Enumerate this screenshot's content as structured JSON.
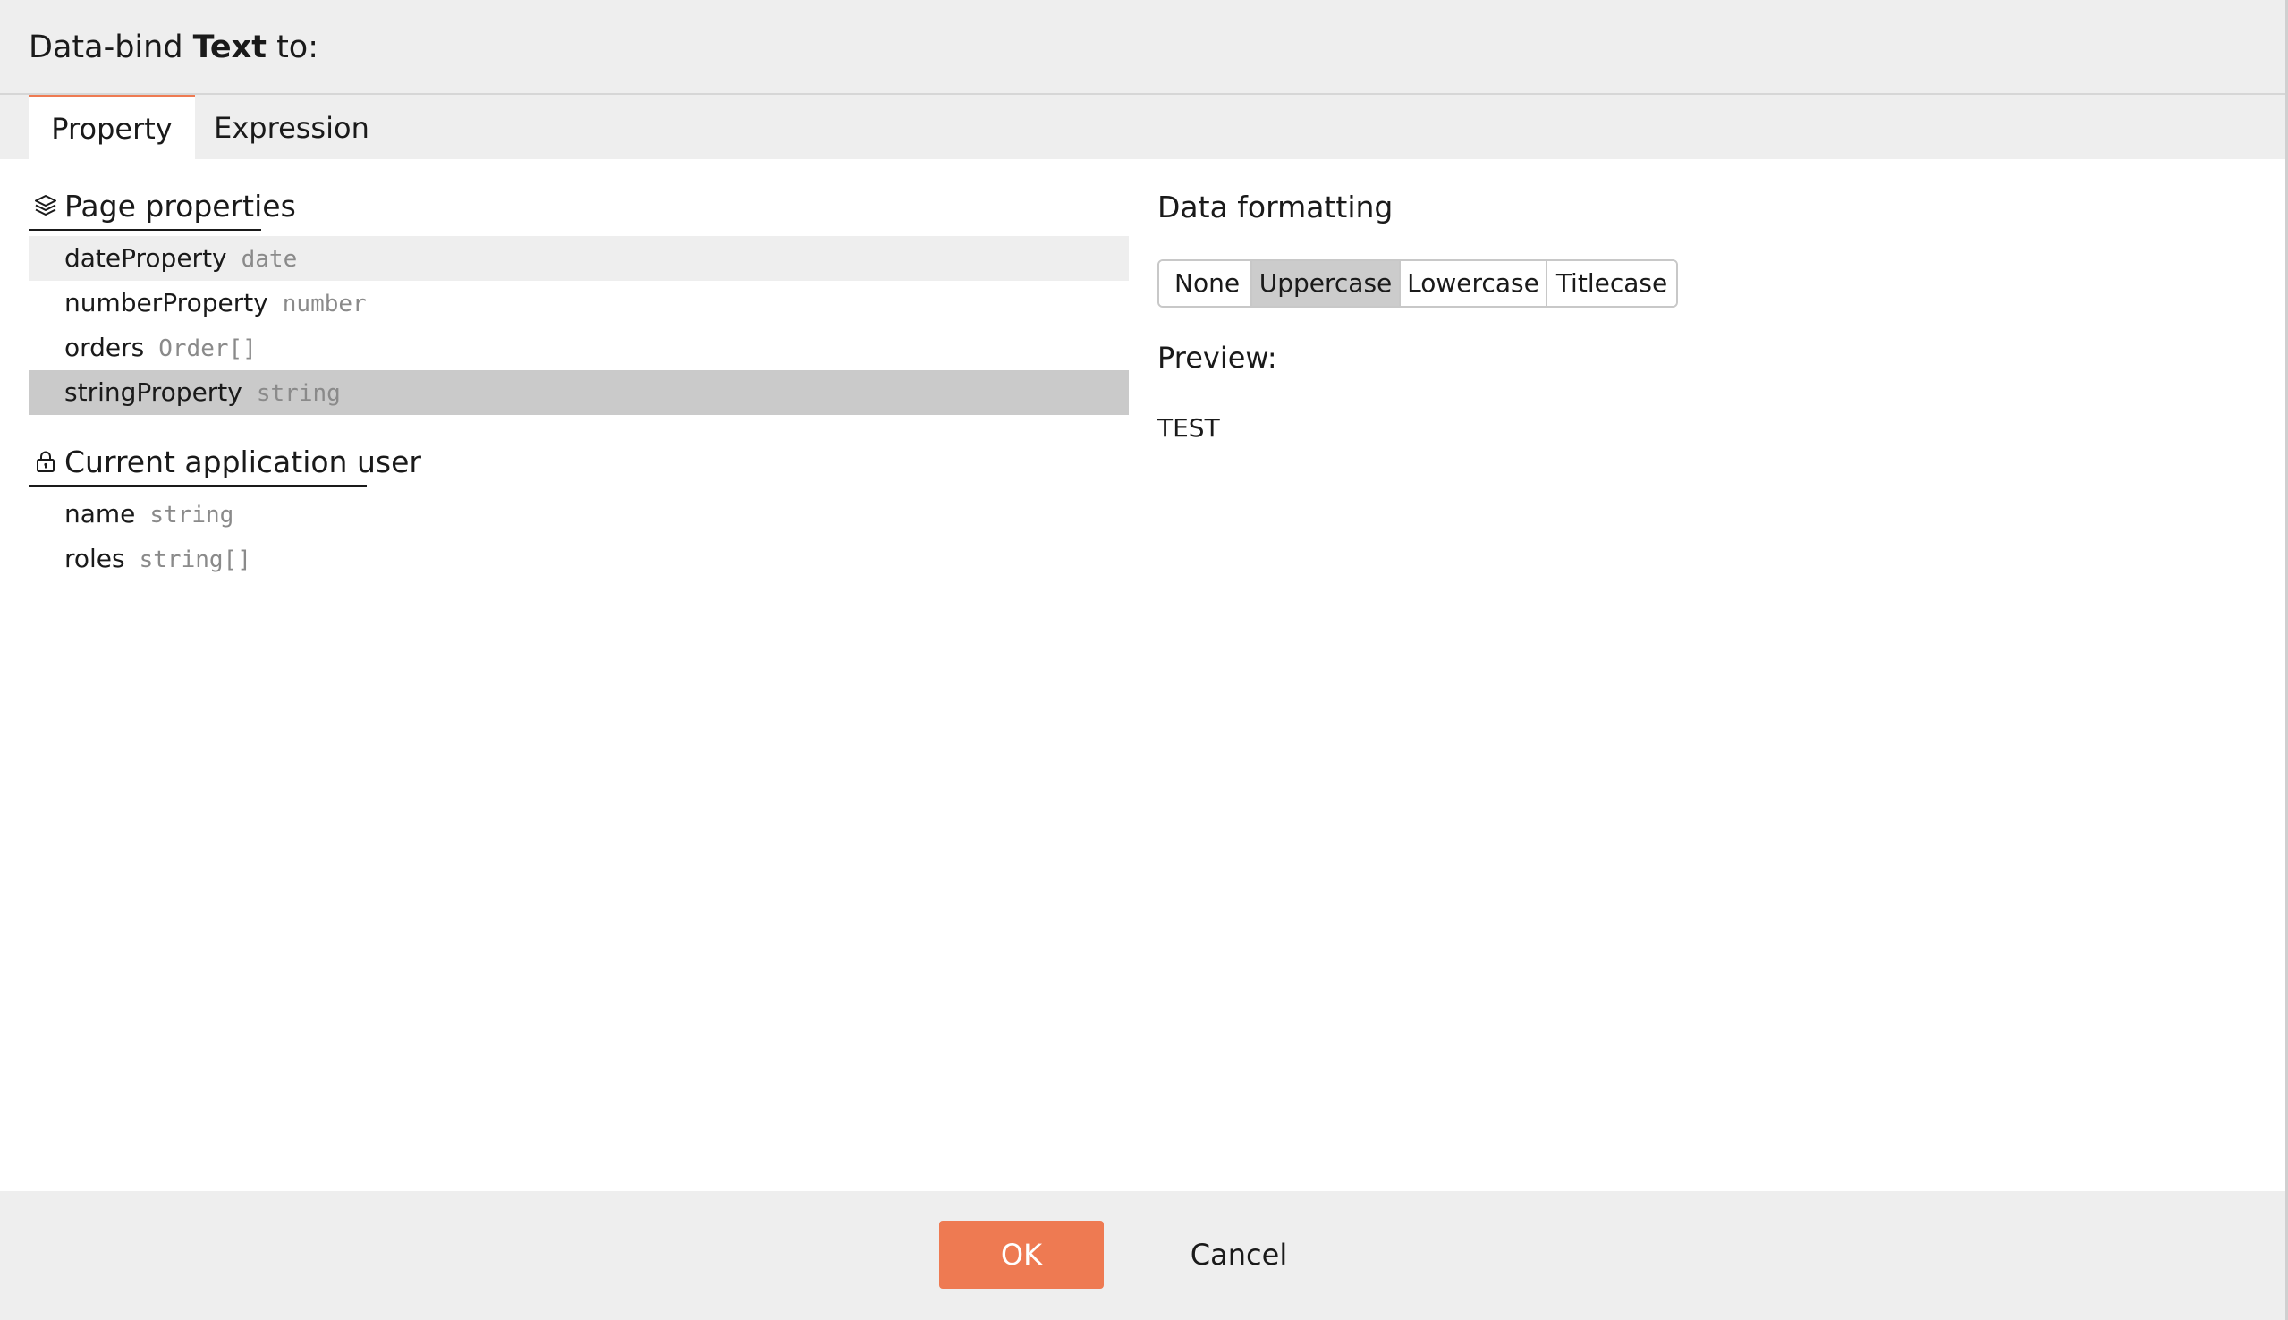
{
  "header": {
    "title_prefix": "Data-bind ",
    "title_bold": "Text",
    "title_suffix": " to:"
  },
  "tabs": [
    {
      "label": "Property",
      "active": true
    },
    {
      "label": "Expression",
      "active": false
    }
  ],
  "sections": {
    "page_properties": {
      "title": "Page properties",
      "icon": "layers-icon",
      "items": [
        {
          "name": "dateProperty",
          "type": "date",
          "state": "hover"
        },
        {
          "name": "numberProperty",
          "type": "number",
          "state": "normal"
        },
        {
          "name": "orders",
          "type": "Order[]",
          "state": "normal"
        },
        {
          "name": "stringProperty",
          "type": "string",
          "state": "selected"
        }
      ]
    },
    "current_user": {
      "title": "Current application user",
      "icon": "lock-icon",
      "items": [
        {
          "name": "name",
          "type": "string",
          "state": "normal"
        },
        {
          "name": "roles",
          "type": "string[]",
          "state": "normal"
        }
      ]
    }
  },
  "formatting": {
    "title": "Data formatting",
    "options": [
      "None",
      "Uppercase",
      "Lowercase",
      "Titlecase"
    ],
    "selected": "Uppercase",
    "preview_label": "Preview:",
    "preview_value": "TEST"
  },
  "footer": {
    "ok_label": "OK",
    "cancel_label": "Cancel"
  },
  "colors": {
    "accent": "#ee7a52",
    "selected_row": "#cacaca",
    "hover_row": "#eeeeee",
    "chrome": "#eeeeee"
  }
}
